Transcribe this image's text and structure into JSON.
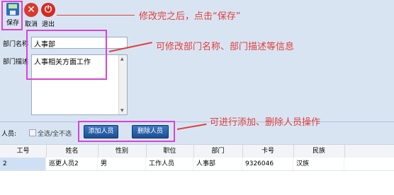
{
  "toolbar": {
    "save_label": "保存",
    "cancel_label": "取消",
    "exit_label": "退出"
  },
  "annotations": {
    "save_note": "修改完之后，点击“保存”",
    "edit_note": "可修改部门名称、部门描述等信息",
    "staff_note": "可进行添加、删除人员操作"
  },
  "form": {
    "name_label": "部门名称",
    "name_value": "人事部",
    "desc_label": "部门描述",
    "desc_value": "人事相关方面工作"
  },
  "staff": {
    "section_label": "人员:",
    "select_all_label": "全选/全不选",
    "add_button": "添加人员",
    "delete_button": "删除人员"
  },
  "table": {
    "columns": [
      "工号",
      "姓名",
      "性别",
      "职位",
      "部门",
      "卡号",
      "民族"
    ],
    "rows": [
      [
        "2",
        "巡更人员2",
        "男",
        "工作人员",
        "人事部",
        "9326046",
        "汉族"
      ]
    ]
  },
  "colors": {
    "annotation_red": "#e0403c",
    "highlight_pink": "#d844d4",
    "button_blue": "#1e4f93"
  }
}
